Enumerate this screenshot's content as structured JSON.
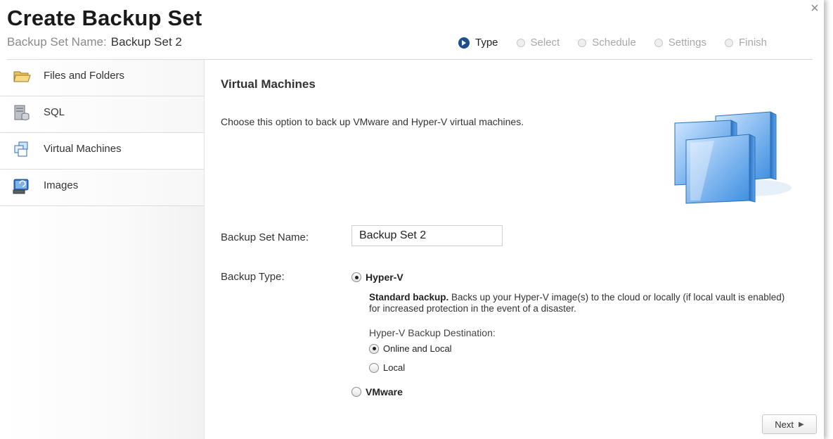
{
  "header": {
    "title": "Create Backup Set",
    "subtitle_label": "Backup Set Name:",
    "subtitle_value": "Backup Set 2",
    "close_glyph": "×"
  },
  "steps": [
    {
      "label": "Type",
      "active": true
    },
    {
      "label": "Select",
      "active": false
    },
    {
      "label": "Schedule",
      "active": false
    },
    {
      "label": "Settings",
      "active": false
    },
    {
      "label": "Finish",
      "active": false
    }
  ],
  "sidebar": {
    "items": [
      {
        "label": "Files and Folders",
        "icon": "folder-icon"
      },
      {
        "label": "SQL",
        "icon": "database-icon"
      },
      {
        "label": "Virtual Machines",
        "icon": "virtual-machine-icon",
        "selected": true
      },
      {
        "label": "Images",
        "icon": "disk-image-icon"
      }
    ]
  },
  "main": {
    "heading": "Virtual Machines",
    "description": "Choose this option to back up VMware and Hyper-V virtual machines.",
    "name_label": "Backup Set Name:",
    "name_value": "Backup Set 2",
    "type_label": "Backup Type:",
    "hyperv_label": "Hyper-V",
    "hyperv_selected": true,
    "standard_bold": "Standard backup.",
    "standard_text": " Backs up your Hyper-V image(s) to the cloud or locally (if local vault is enabled) for increased protection in the event of a disaster.",
    "destination_label": "Hyper-V Backup Destination:",
    "dest_online_local": "Online and Local",
    "dest_local": "Local",
    "vmware_label": "VMware"
  },
  "footer": {
    "next_label": "Next",
    "next_glyph": "▶"
  },
  "colors": {
    "accent": "#1d4f8c",
    "vm_art_blue": "#3d8ee0"
  }
}
